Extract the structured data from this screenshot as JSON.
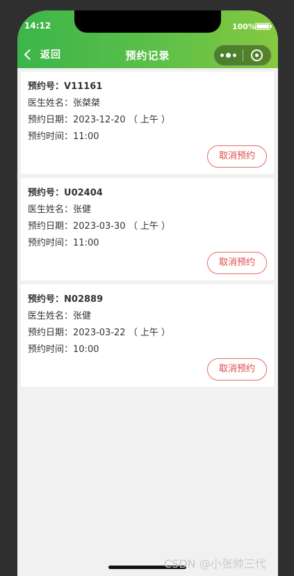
{
  "status_bar": {
    "time": "14:12",
    "battery": "100%"
  },
  "nav": {
    "back_label": "返回",
    "title": "预约记录"
  },
  "appointments": [
    {
      "no_label": "预约号：",
      "no": "V11161",
      "doctor_label": "医生姓名：",
      "doctor": "张桀桀",
      "date_label": "预约日期：",
      "date": "2023-12-20 （ 上午 ）",
      "time_label": "预约时间：",
      "time": "11:00",
      "cancel_label": "取消预约"
    },
    {
      "no_label": "预约号：",
      "no": "U02404",
      "doctor_label": "医生姓名：",
      "doctor": "张健",
      "date_label": "预约日期：",
      "date": "2023-03-30 （ 上午 ）",
      "time_label": "预约时间：",
      "time": "11:00",
      "cancel_label": "取消预约"
    },
    {
      "no_label": "预约号：",
      "no": "N02889",
      "doctor_label": "医生姓名：",
      "doctor": "张健",
      "date_label": "预约日期：",
      "date": "2023-03-22 （ 上午 ）",
      "time_label": "预约时间：",
      "time": "10:00",
      "cancel_label": "取消预约"
    }
  ],
  "watermark": "CSDN @小张帅三代",
  "colors": {
    "header_start": "#3cb54a",
    "header_end": "#86c93e",
    "cancel": "#e04848",
    "page_bg": "#f1f1f1"
  },
  "icons": {
    "back": "chevron-left-icon",
    "menu": "more-dots-icon",
    "close": "target-circle-icon"
  }
}
